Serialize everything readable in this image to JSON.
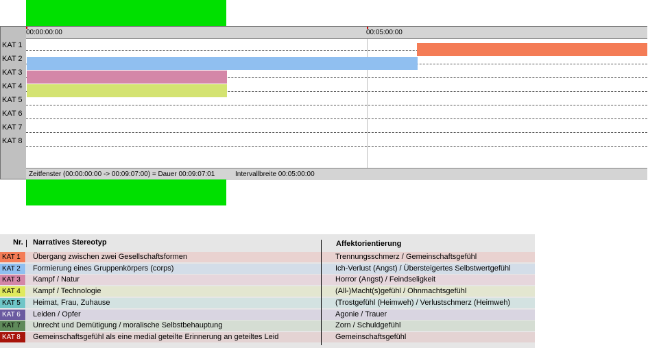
{
  "timeline": {
    "ticks": [
      "00:00:00:00",
      "00:05:00:00"
    ],
    "rows": [
      "KAT 1",
      "KAT 2",
      "KAT 3",
      "KAT 4",
      "KAT 5",
      "KAT 6",
      "KAT 7",
      "KAT 8"
    ],
    "segments": [
      {
        "row": "KAT 1",
        "start": "00:05:08",
        "end": "00:09:07",
        "color": "#f47c56"
      },
      {
        "row": "KAT 2",
        "start": "00:00:00",
        "end": "00:05:08",
        "color": "#90bff0"
      },
      {
        "row": "KAT 3",
        "start": "00:00:00",
        "end": "00:02:39",
        "color": "#d487a8"
      },
      {
        "row": "KAT 4",
        "start": "00:00:00",
        "end": "00:02:39",
        "color": "#d4e372"
      }
    ],
    "status_window": "Zeitfenster (00:00:00:00 -> 00:09:07:00) = Dauer 00:09:07:01",
    "status_interval": "Intervallbreite 00:05:00:00"
  },
  "legend": {
    "header_nr": "Nr.",
    "header_stereotyp": "Narratives Stereotyp",
    "header_affekt": "Affektorientierung",
    "rows": [
      {
        "kat": "KAT 1",
        "stereotyp": "Übergang zwischen zwei Gesellschaftsformen",
        "affekt": "Trennungsschmerz / Gemeinschaftsgefühl",
        "color": "#f47c56",
        "band": "#e9d2d0"
      },
      {
        "kat": "KAT 2",
        "stereotyp": "Formierung eines Gruppenkörpers (corps)",
        "affekt": "Ich-Verlust (Angst) / Übersteigertes Selbstwertgefühl",
        "color": "#90bff0",
        "band": "#d3dde8"
      },
      {
        "kat": "KAT 3",
        "stereotyp": "Kampf / Natur",
        "affekt": "Horror (Angst) / Feindseligkeit",
        "color": "#d487a8",
        "band": "#e6d6dc"
      },
      {
        "kat": "KAT 4",
        "stereotyp": "Kampf / Technologie",
        "affekt": "(All-)Macht(s)gefühl / Ohnmachtsgefühl",
        "color": "#e0ea5e",
        "band": "#e3e6d0"
      },
      {
        "kat": "KAT 5",
        "stereotyp": "Heimat, Frau, Zuhause",
        "affekt": "(Trostgefühl (Heimweh) / Verlustschmerz (Heimweh)",
        "color": "#6fc6c8",
        "band": "#d3e2e1"
      },
      {
        "kat": "KAT 6",
        "stereotyp": "Leiden / Opfer",
        "affekt": "Agonie / Trauer",
        "color": "#6a5aa0",
        "band": "#d9d5e1"
      },
      {
        "kat": "KAT 7",
        "stereotyp": "Unrecht und Demütigung / moralische Selbstbehauptung",
        "affekt": "Zorn / Schuldgefühl",
        "color": "#5f8a5a",
        "band": "#d5ddd3"
      },
      {
        "kat": "KAT 8",
        "stereotyp": "Gemeinschaftsgefühl als eine medial geteilte Erinnerung an geteiltes Leid",
        "affekt": "Gemeinschaftsgefühl",
        "color": "#a8140a",
        "band": "#e4d3d3"
      }
    ]
  }
}
